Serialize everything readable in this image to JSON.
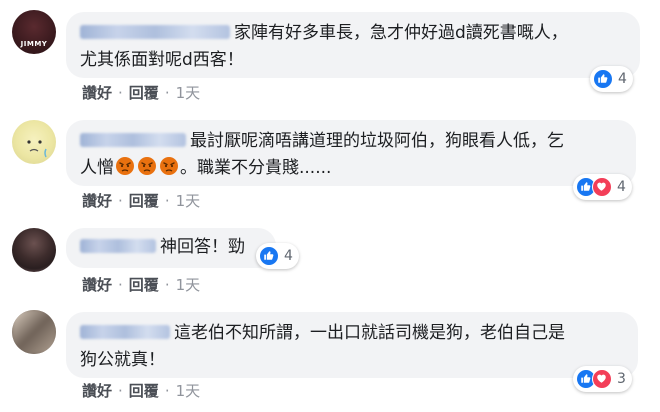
{
  "comments": [
    {
      "text_line1": "家陣有好多車長，急才仲好過d讀死書嘅人，",
      "text_line2": "尤其係面對呢d西客！",
      "avatar_label": "JIMMY",
      "like_label": "讚好",
      "reply_label": "回覆",
      "time": "1天",
      "reaction_count": "4",
      "reactions": [
        "like"
      ]
    },
    {
      "text_line1": "最討厭呢滴唔講道理的垃圾阿伯，狗眼看人低，乞",
      "text_line2_a": "人憎",
      "text_line2_b": "。職業不分貴賤......",
      "angry_emoji_count": 3,
      "like_label": "讚好",
      "reply_label": "回覆",
      "time": "1天",
      "reaction_count": "4",
      "reactions": [
        "like",
        "love"
      ]
    },
    {
      "text_line1": "神回答！勁",
      "like_label": "讚好",
      "reply_label": "回覆",
      "time": "1天",
      "reaction_count": "4",
      "reactions": [
        "like"
      ]
    },
    {
      "text_line1": "這老伯不知所謂，一出口就話司機是狗，老伯自己是",
      "text_line2": "狗公就真！",
      "like_label": "讚好",
      "reply_label": "回覆",
      "time": "1天",
      "reaction_count": "3",
      "reactions": [
        "like",
        "love"
      ]
    }
  ],
  "colors": {
    "like_blue": "#1877f2",
    "love_red": "#f33e58",
    "angry_orange": "#e9710f",
    "bubble_bg": "#f2f3f5"
  }
}
